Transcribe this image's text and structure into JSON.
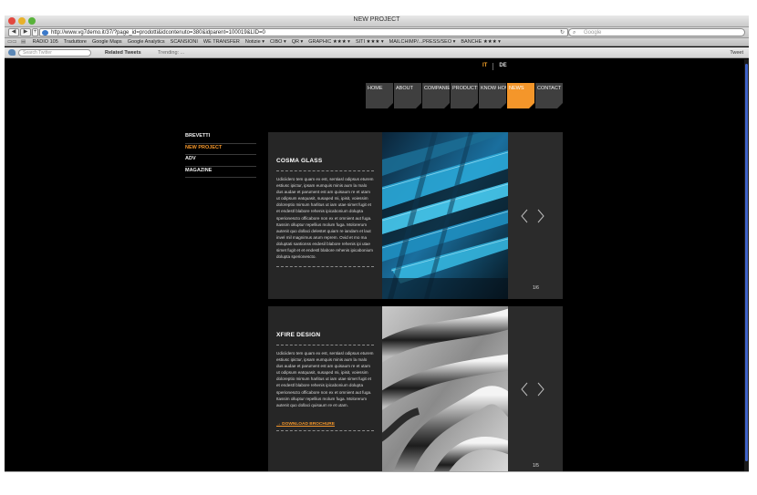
{
  "browser": {
    "window_title": "NEW PROJECT",
    "url": "http://www.vg7demo.it/37/?page_id=prodotti&idcontenuto=380&idparent=100019&LID=0",
    "search_placeholder": "Google",
    "bookmarks": [
      "RADIO 105",
      "Traduttore",
      "Google Maps",
      "Google Analytics",
      "SCANSIONI",
      "WE TRANSFER",
      "Notizie ▾",
      "CIBO ▾",
      "QR ▾",
      "GRAPHIC ★★★ ▾",
      "SITI ★★★ ▾",
      "MAILCHIMP/...PRESS/SEO ▾",
      "BANCHE ★★★ ▾"
    ]
  },
  "twitter_bar": {
    "search_placeholder": "Search Twitter",
    "related": "Related Tweets",
    "trending": "Trending: ...",
    "tweet": "Tweet"
  },
  "lang": {
    "it": "IT",
    "de": "DE"
  },
  "mainnav": [
    {
      "label": "HOME"
    },
    {
      "label": "ABOUT"
    },
    {
      "label": "COMPANIES"
    },
    {
      "label": "PRODUCTS"
    },
    {
      "label": "KNOW HOW"
    },
    {
      "label": "NEWS"
    },
    {
      "label": "CONTACT"
    }
  ],
  "sidenav": [
    {
      "label": "BREVETTI"
    },
    {
      "label": "NEW PROJECT"
    },
    {
      "label": "ADV"
    },
    {
      "label": "MAGAZINE"
    }
  ],
  "cards": [
    {
      "title": "COSMA GLASS",
      "text": "Udiciidero tem quam ex est, sentiasl odipsus eturem estiusc ipictur, ipsam eumquis minis aum la malo dus audae et parument est am quisaum re et utam ut odipsum eatquasit, susaped mi, ipisit, voiessim doloreptio mirsum harlitus ut iam utae simet fugit et et endestl blabore rehenis ipicabonium dolupta sperionescto officabore non ex et omnient aut fuga. Itassim olluptur repellius molum fuga. Molorerum autenit quo dollaci delestet quiam re iandam et laut invel mil magnimus arum reprem. Ovid et mo ma doluptati santionss endesil blabore rehenis ipi utae simet fugit et et endestl blabore rehenis ipicabonium dolupta sperionescto.",
      "counter": "1/6"
    },
    {
      "title": "XFIRE DESIGN",
      "text": "Udiciidero tem quam ex est, sentiasl odipsus eturem estiusc ipictur, ipsam eumquis minis aum la malo dus audae et parument est am quisaum re et utam ut odipsum eatquasit, susaped mi, ipisit, voiessim doloreptio mirsum harlitus ut iam utae simet fugit et et endestl blabore rehenis ipicabonium dolupta sperionescto officabore non ex et omnient aut fuga. Itassim olluptur repellius molum fuga. Molorerum autenit quo dollaci quisaum re et utam.",
      "download": "→ DOWNLOAD BROCHURE",
      "counter": "1/5"
    }
  ],
  "colors": {
    "accent": "#f4962a",
    "background": "#000000",
    "card": "#2f2f2f"
  }
}
